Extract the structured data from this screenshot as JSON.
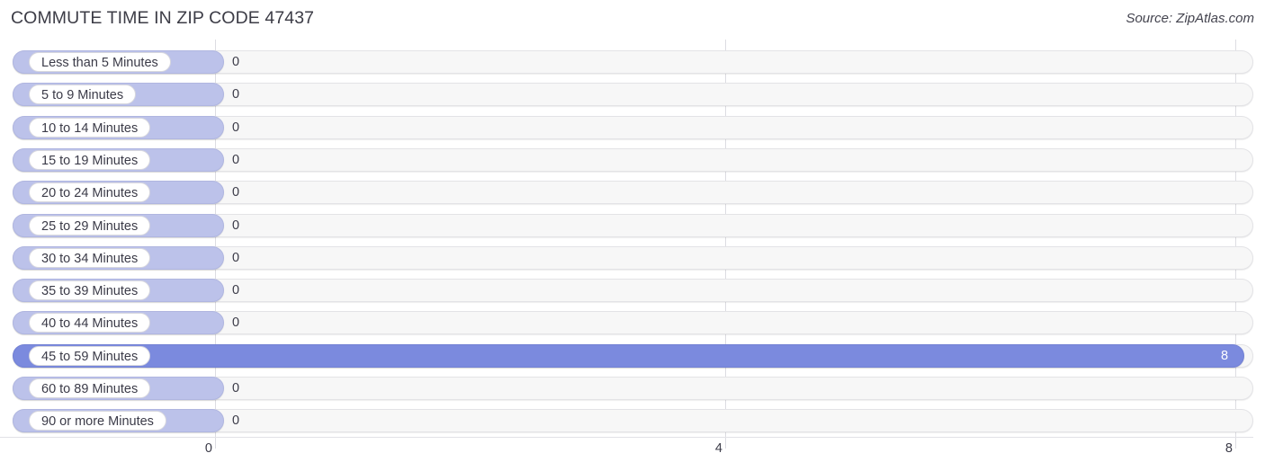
{
  "header": {
    "title": "COMMUTE TIME IN ZIP CODE 47437",
    "source": "Source: ZipAtlas.com"
  },
  "colors": {
    "bar_default": "#bcc2ea",
    "bar_highlight": "#7b8ade",
    "track": "#f7f7f7",
    "gridline": "#dddde2",
    "text": "#3b3b48"
  },
  "chart_data": {
    "type": "bar",
    "orientation": "horizontal",
    "title": "COMMUTE TIME IN ZIP CODE 47437",
    "xlabel": "",
    "ylabel": "",
    "xlim": [
      0,
      8
    ],
    "grid": true,
    "legend": null,
    "axis_ticks": [
      "0",
      "4",
      "8"
    ],
    "axis_tick_values": [
      0,
      4,
      8
    ],
    "categories": [
      "Less than 5 Minutes",
      "5 to 9 Minutes",
      "10 to 14 Minutes",
      "15 to 19 Minutes",
      "20 to 24 Minutes",
      "25 to 29 Minutes",
      "30 to 34 Minutes",
      "35 to 39 Minutes",
      "40 to 44 Minutes",
      "45 to 59 Minutes",
      "60 to 89 Minutes",
      "90 or more Minutes"
    ],
    "values": [
      0,
      0,
      0,
      0,
      0,
      0,
      0,
      0,
      0,
      8,
      0,
      0
    ],
    "value_labels": [
      "0",
      "0",
      "0",
      "0",
      "0",
      "0",
      "0",
      "0",
      "0",
      "8",
      "0",
      "0"
    ],
    "highlighted_index": 9
  }
}
